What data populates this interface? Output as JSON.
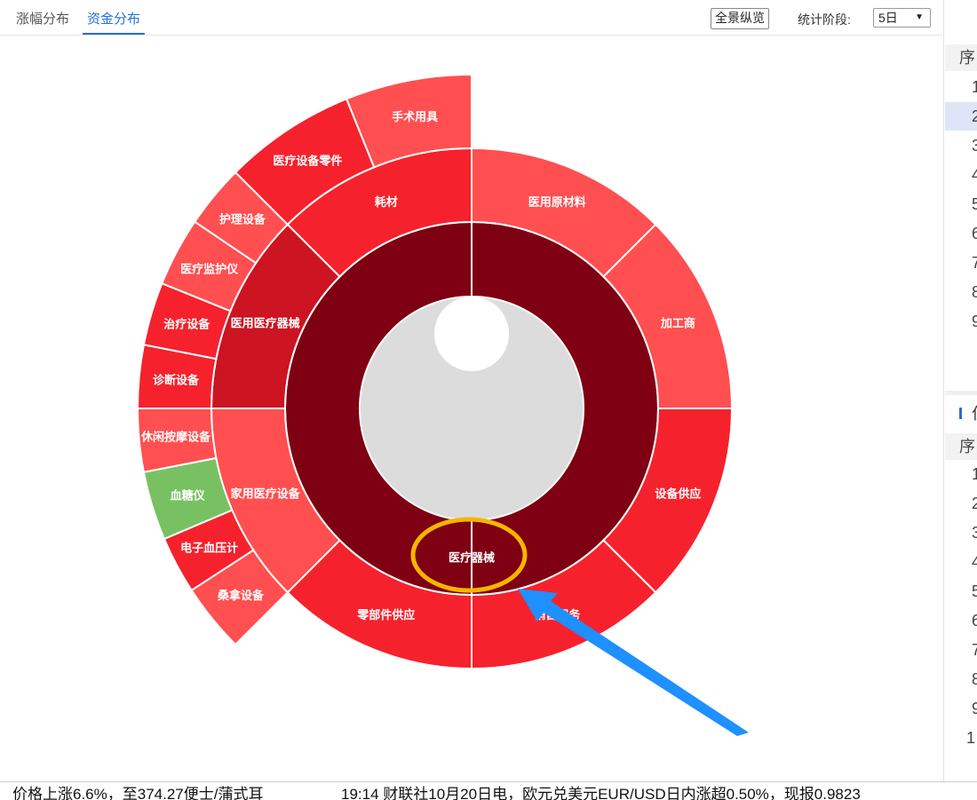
{
  "tabs": [
    {
      "label": "涨幅分布",
      "active": false
    },
    {
      "label": "资金分布",
      "active": true
    }
  ],
  "toolbar": {
    "overview_label": "全景纵览",
    "stat_label": "统计阶段:",
    "period_value": "5日"
  },
  "chart_data": {
    "type": "sunburst",
    "root": "医疗器械",
    "colors": {
      "dark": "#7e0012",
      "mid_red": "#f5222d",
      "light_red": "#ff4f51",
      "crimson": "#cc1422",
      "green": "#78c163",
      "grey": "#dcdcdc"
    },
    "segments": [
      {
        "name": "医用原材料",
        "ring": 2,
        "start": 0,
        "end": 45,
        "color": "#ff4f51"
      },
      {
        "name": "加工商",
        "ring": 2,
        "start": 45,
        "end": 90,
        "color": "#ff4f51"
      },
      {
        "name": "设备供应",
        "ring": 2,
        "start": 90,
        "end": 135,
        "color": "#f5222d"
      },
      {
        "name": "销售服务",
        "ring": 2,
        "start": 135,
        "end": 180,
        "color": "#f5222d"
      },
      {
        "name": "零部件供应",
        "ring": 2,
        "start": 180,
        "end": 225,
        "color": "#f5222d"
      },
      {
        "name": "家用医疗设备",
        "ring": 2,
        "start": 225,
        "end": 270,
        "color": "#ff4f51"
      },
      {
        "name": "医用医疗器械",
        "ring": 2,
        "start": 270,
        "end": 315,
        "color": "#cc1422"
      },
      {
        "name": "耗材",
        "ring": 2,
        "start": 315,
        "end": 360,
        "color": "#f5222d"
      },
      {
        "name": "桑拿设备",
        "ring": 3,
        "start": 225,
        "end": 237,
        "color": "#ff4f51"
      },
      {
        "name": "电子血压计",
        "ring": 3,
        "start": 237,
        "end": 247,
        "color": "#f5222d"
      },
      {
        "name": "血糖仪",
        "ring": 3,
        "start": 247,
        "end": 259,
        "color": "#78c163"
      },
      {
        "name": "休闲按摩设备",
        "ring": 3,
        "start": 259,
        "end": 270,
        "color": "#ff4f51"
      },
      {
        "name": "诊断设备",
        "ring": 3,
        "start": 270,
        "end": 281,
        "color": "#f5222d"
      },
      {
        "name": "治疗设备",
        "ring": 3,
        "start": 281,
        "end": 292,
        "color": "#f5222d"
      },
      {
        "name": "医疗监护仪",
        "ring": 3,
        "start": 292,
        "end": 304,
        "color": "#ff4f51"
      },
      {
        "name": "护理设备",
        "ring": 3,
        "start": 304,
        "end": 315,
        "color": "#ff4f51"
      },
      {
        "name": "医疗设备零件",
        "ring": 3,
        "start": 315,
        "end": 338,
        "color": "#f5222d"
      },
      {
        "name": "手术用具",
        "ring": 3,
        "start": 338,
        "end": 360,
        "color": "#ff4f51"
      }
    ]
  },
  "right_panel": {
    "header_top": "序",
    "top_numbers": [
      "1",
      "2",
      "3",
      "4",
      "5",
      "6",
      "7",
      "8",
      "9"
    ],
    "highlight_index": 1,
    "section_char": "位",
    "header_bottom": "序",
    "bottom_numbers": [
      "1",
      "2",
      "3",
      "4",
      "5",
      "6",
      "7",
      "8",
      "9",
      "1"
    ]
  },
  "ticker": {
    "item1": "价格上涨6.6%，至374.27便士/蒲式耳",
    "item2": "19:14 财联社10月20日电，欧元兑美元EUR/USD日内涨超0.50%，现报0.9823"
  }
}
